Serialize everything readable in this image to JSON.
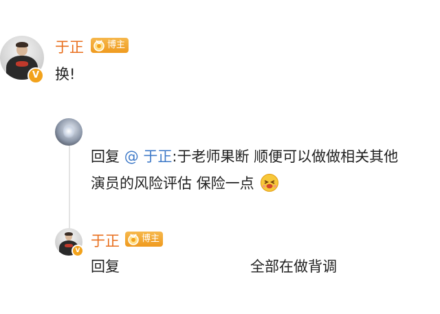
{
  "comment": {
    "username": "于正",
    "badge": "博主",
    "text": "换!"
  },
  "reply": {
    "reply_word": "回复",
    "mention": "@ 于正",
    "text_line1": ":于老师果断 顺便可以做做相关其他",
    "text_line2": "演员的风险评估 保险一点",
    "emoji": "squinting-laugh-emoji"
  },
  "sub_reply": {
    "username": "于正",
    "badge": "博主",
    "reply_word": "回复",
    "text": "全部在做背调"
  },
  "colors": {
    "username": "#e86e1c",
    "badge": "#ef9a1e",
    "mention": "#3f7ac8",
    "text": "#1f1f1f"
  },
  "icons": [
    "v-badge-icon",
    "medal-icon",
    "emoji-icon"
  ]
}
